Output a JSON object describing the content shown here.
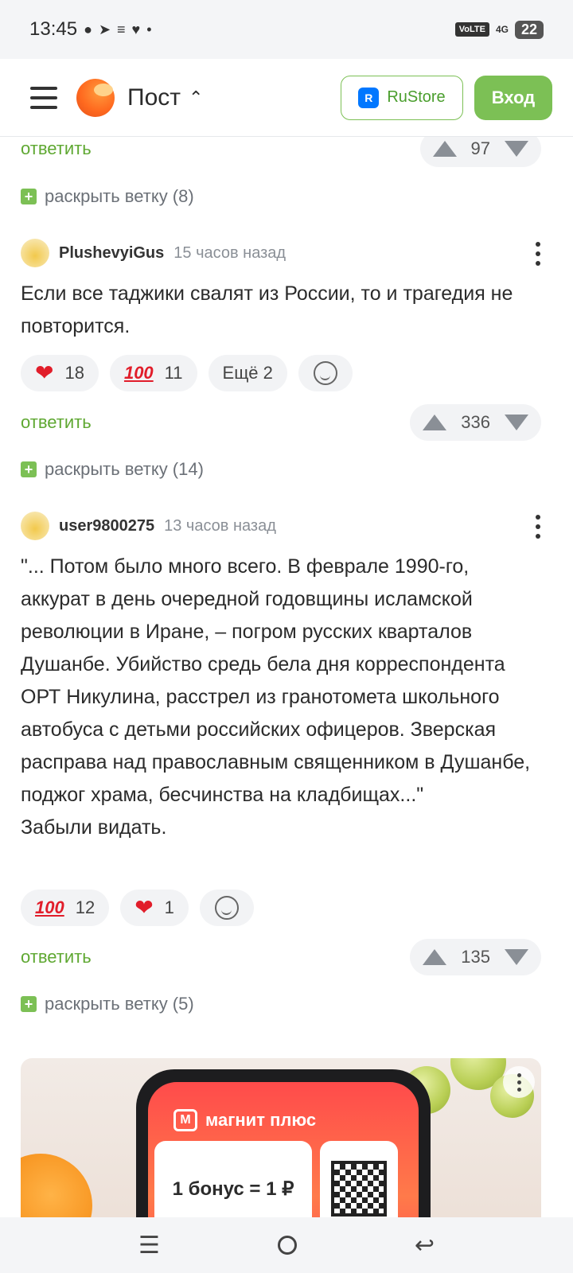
{
  "status_bar": {
    "time": "13:45",
    "volte": "VoLTE",
    "network": "4G",
    "battery": "22"
  },
  "header": {
    "title": "Пост",
    "rustore_label": "RuStore",
    "rustore_logo": "R",
    "login_label": "Вход"
  },
  "top_fragment": {
    "reply_label": "ответить",
    "score": "97",
    "expand_label": "раскрыть ветку (8)"
  },
  "comments": [
    {
      "username": "PlushevyiGus",
      "time": "15 часов назад",
      "text": "Если все таджики свалят из России, то и трагедия не повторится.",
      "reactions": [
        {
          "icon": "heart-icon",
          "count": "18"
        },
        {
          "icon": "hundred-icon",
          "count": "11"
        }
      ],
      "more_label": "Ещё 2",
      "reply_label": "ответить",
      "score": "336",
      "expand_label": "раскрыть ветку (14)"
    },
    {
      "username": "user9800275",
      "time": "13 часов назад",
      "text": "\"... Потом было много всего. В феврале 1990-го, аккурат в день очередной годовщины исламской революции в Иране, – погром русских кварталов Душанбе. Убийство средь бела дня корреспондента ОРТ Никулина, расстрел из гранотомета школьного автобуса с детьми российских офицеров. Зверская расправа над православным священником в Душанбе, поджог храма, бесчинства на кладбищах...\"\nЗабыли видать.",
      "reactions": [
        {
          "icon": "hundred-icon",
          "count": "12"
        },
        {
          "icon": "heart-icon",
          "count": "1"
        }
      ],
      "reply_label": "ответить",
      "score": "135",
      "expand_label": "раскрыть ветку (5)"
    }
  ],
  "ad": {
    "brand": "магнит плюс",
    "brand_mark": "М",
    "offer": "1 бонус = 1 ₽"
  },
  "glyphs": {
    "heart": "❤",
    "hundred": "100",
    "menu": "☰",
    "back": "↩",
    "chevron_up": "⌃",
    "plus": "+"
  }
}
